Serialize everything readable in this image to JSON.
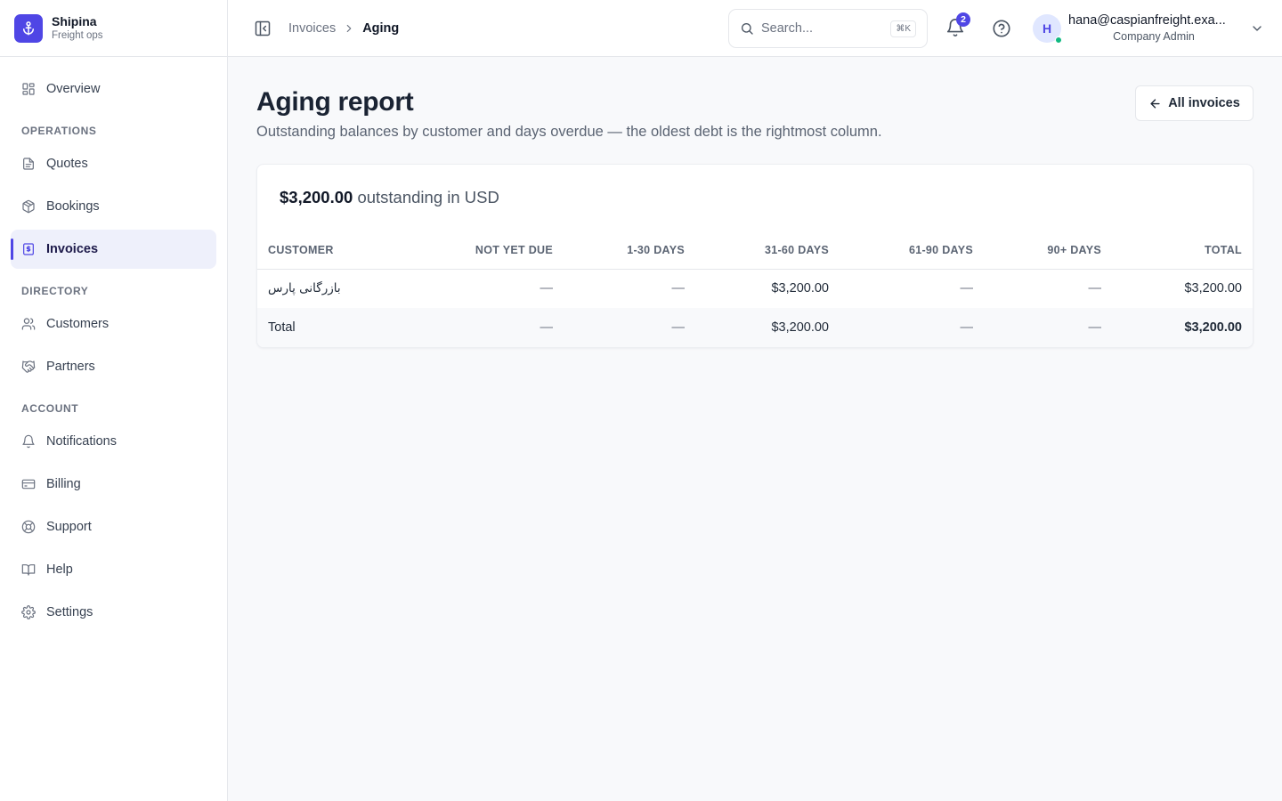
{
  "brand": {
    "name": "Shipina",
    "subtitle": "Freight ops"
  },
  "sidebar": {
    "top": [
      {
        "label": "Overview",
        "icon": "grid-icon"
      }
    ],
    "sections": [
      {
        "title": "OPERATIONS",
        "items": [
          {
            "label": "Quotes",
            "icon": "document-icon"
          },
          {
            "label": "Bookings",
            "icon": "package-icon"
          },
          {
            "label": "Invoices",
            "icon": "receipt-icon",
            "active": true
          }
        ]
      },
      {
        "title": "DIRECTORY",
        "items": [
          {
            "label": "Customers",
            "icon": "users-icon"
          },
          {
            "label": "Partners",
            "icon": "handshake-icon"
          }
        ]
      },
      {
        "title": "ACCOUNT",
        "items": [
          {
            "label": "Notifications",
            "icon": "bell-icon"
          },
          {
            "label": "Billing",
            "icon": "credit-card-icon"
          },
          {
            "label": "Support",
            "icon": "lifebuoy-icon"
          },
          {
            "label": "Help",
            "icon": "book-icon"
          },
          {
            "label": "Settings",
            "icon": "gear-icon"
          }
        ]
      }
    ]
  },
  "topbar": {
    "breadcrumb": {
      "parent": "Invoices",
      "current": "Aging"
    },
    "search": {
      "placeholder": "Search...",
      "shortcut": "⌘K"
    },
    "notifications_count": "2",
    "user": {
      "initial": "H",
      "email": "hana@caspianfreight.exa...",
      "role": "Company Admin"
    }
  },
  "page": {
    "title": "Aging report",
    "subtitle": "Outstanding balances by customer and days overdue — the oldest debt is the rightmost column.",
    "back_button": "All invoices",
    "summary": {
      "amount": "$3,200.00",
      "text": "outstanding in USD"
    }
  },
  "table": {
    "columns": [
      "CUSTOMER",
      "NOT YET DUE",
      "1-30 DAYS",
      "31-60 DAYS",
      "61-90 DAYS",
      "90+ DAYS",
      "TOTAL"
    ],
    "rows": [
      {
        "customer": "بازرگانی پارس",
        "not_yet_due": "—",
        "d1_30": "—",
        "d31_60": "$3,200.00",
        "d61_90": "—",
        "d90_plus": "—",
        "total": "$3,200.00"
      }
    ],
    "total_row": {
      "label": "Total",
      "not_yet_due": "—",
      "d1_30": "—",
      "d31_60": "$3,200.00",
      "d61_90": "—",
      "d90_plus": "—",
      "total": "$3,200.00"
    }
  },
  "colors": {
    "accent": "#4f46e5",
    "presence": "#10b981",
    "page_bg": "#f8f9fb"
  }
}
